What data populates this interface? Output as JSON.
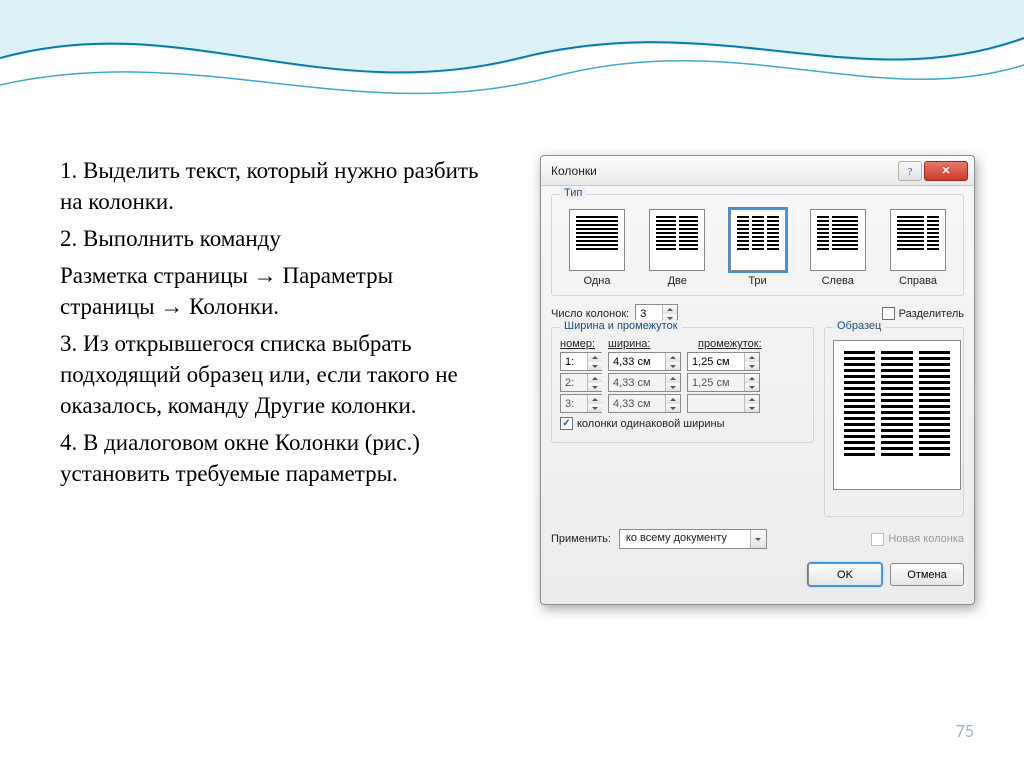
{
  "page_number": "75",
  "instructions": {
    "p1": "1. Выделить текст, который нужно разбить на колонки.",
    "p2": "2. Выполнить команду",
    "p3": "Разметка страницы → Параметры страницы → Колонки.",
    "p4": "3. Из открывшегося списка выбрать подходящий образец или, если такого не оказалось, команду Другие колонки.",
    "p5": "4. В диалоговом окне Колонки (рис.) установить требуемые параметры."
  },
  "dialog": {
    "title": "Колонки",
    "group_type_title": "Тип",
    "types": {
      "one": "Одна",
      "two": "Две",
      "three": "Три",
      "left": "Слева",
      "right": "Справа",
      "selected": "three"
    },
    "num_cols_label": "Число колонок:",
    "num_cols_value": "3",
    "separator_label": "Разделитель",
    "group_width_title": "Ширина и промежуток",
    "preview_title": "Образец",
    "headers": {
      "num": "номер:",
      "width": "ширина:",
      "gap": "промежуток:"
    },
    "rows": [
      {
        "n": "1:",
        "width": "4,33 см",
        "gap": "1,25 см",
        "enabled": true
      },
      {
        "n": "2:",
        "width": "4,33 см",
        "gap": "1,25 см",
        "enabled": false
      },
      {
        "n": "3:",
        "width": "4,33 см",
        "gap": "",
        "enabled": false
      }
    ],
    "equal_width_label": "колонки одинаковой ширины",
    "apply_label": "Применить:",
    "apply_value": "ко всему документу",
    "new_col_label": "Новая колонка",
    "ok": "OK",
    "cancel": "Отмена"
  }
}
